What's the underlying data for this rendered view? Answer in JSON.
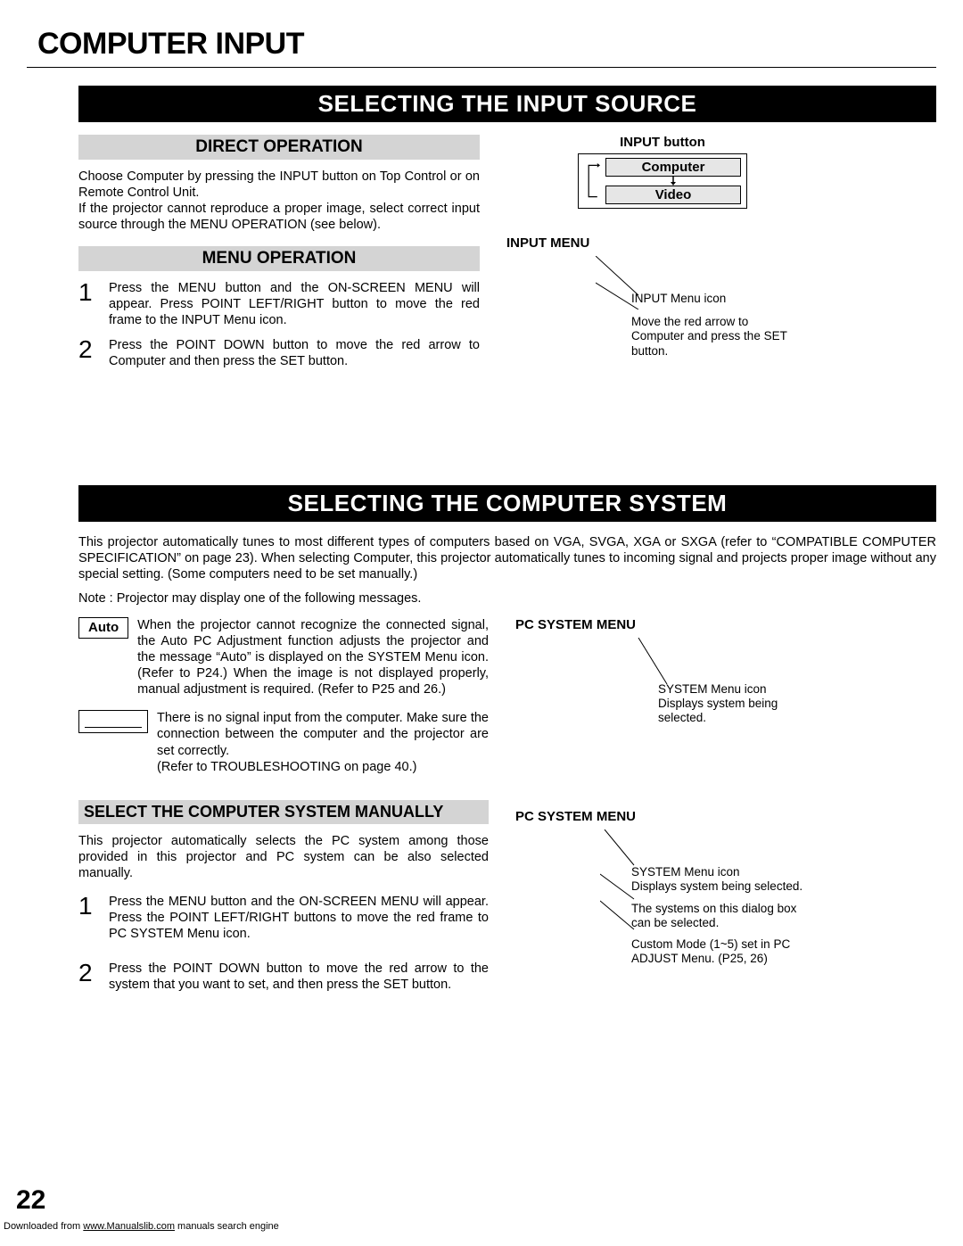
{
  "pageTitle": "COMPUTER INPUT",
  "section1": {
    "banner": "SELECTING THE INPUT SOURCE",
    "direct": {
      "heading": "DIRECT OPERATION",
      "text": "Choose Computer by pressing the INPUT button on Top Control or on Remote Control Unit.\nIf the projector cannot reproduce a proper image, select correct input source through the MENU OPERATION (see below)."
    },
    "menu": {
      "heading": "MENU OPERATION",
      "step1": "Press the MENU button and the ON-SCREEN MENU will appear.  Press POINT LEFT/RIGHT button to move the red frame to the INPUT Menu icon.",
      "step2": "Press the POINT DOWN button to move the red arrow to Computer and then press the SET button."
    },
    "right": {
      "inputButtonLabel": "INPUT button",
      "opt1": "Computer",
      "opt2": "Video",
      "inputMenuLabel": "INPUT MENU",
      "callout1": "INPUT Menu icon",
      "callout2": "Move the red arrow to Computer and press the SET button."
    }
  },
  "section2": {
    "banner": "SELECTING THE COMPUTER SYSTEM",
    "intro": "This projector automatically tunes to most different types of computers based on VGA, SVGA, XGA or SXGA (refer to “COMPATIBLE COMPUTER SPECIFICATION” on page 23).  When selecting Computer, this projector automatically tunes to incoming signal and projects proper image without any special setting.  (Some computers need to be set manually.)",
    "note": "Note : Projector may display one of the following messages.",
    "autoLabel": "Auto",
    "autoText": "When the projector cannot recognize the connected signal, the Auto PC Adjustment function adjusts the projector and the message “Auto” is displayed on the SYSTEM Menu icon.  (Refer to P24.)  When the image is not displayed properly, manual adjustment is required.  (Refer to P25 and 26.)",
    "blankText": "There is no signal input from the computer.  Make sure the connection between the computer and the projector are set correctly.\n(Refer to TROUBLESHOOTING on page 40.)",
    "right1": {
      "label": "PC SYSTEM MENU",
      "callout": "SYSTEM Menu icon\nDisplays system being selected."
    },
    "manual": {
      "heading": "SELECT THE COMPUTER SYSTEM MANUALLY",
      "intro": "This projector automatically selects the PC system among those provided in this projector and PC system can be also selected manually.",
      "step1": "Press the MENU button and the ON-SCREEN MENU will appear. Press the POINT LEFT/RIGHT buttons to move the red frame to PC SYSTEM Menu icon.",
      "step2": "Press the POINT DOWN button to move the red arrow to the system that you want to set, and then press the SET button."
    },
    "right2": {
      "label": "PC SYSTEM MENU",
      "callout1": "SYSTEM Menu icon\nDisplays system being selected.",
      "callout2": "The systems on this dialog box can be selected.",
      "callout3": "Custom Mode (1~5) set in PC ADJUST Menu.  (P25, 26)"
    }
  },
  "pageNumber": "22",
  "footer": {
    "pre": "Downloaded from ",
    "link": "www.Manualslib.com",
    "post": " manuals search engine"
  }
}
